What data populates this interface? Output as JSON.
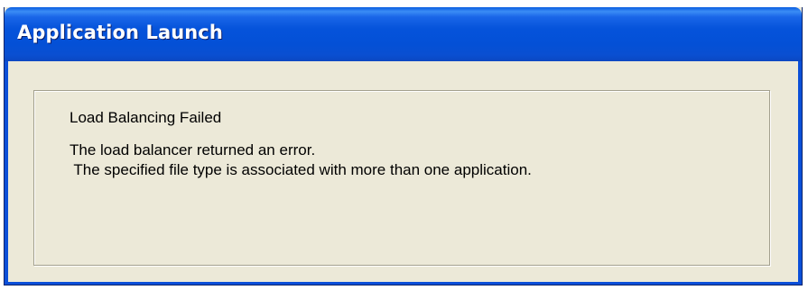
{
  "window": {
    "title": "Application Launch"
  },
  "message": {
    "heading": "Load Balancing Failed",
    "line1": "The load balancer returned an error.",
    "line2": " The specified file type is associated with more than one application."
  },
  "colors": {
    "titlebar": "#0553db",
    "title_text": "#ffffff",
    "dialog_background": "#ece9d8",
    "group_border": "#a3a08e"
  }
}
